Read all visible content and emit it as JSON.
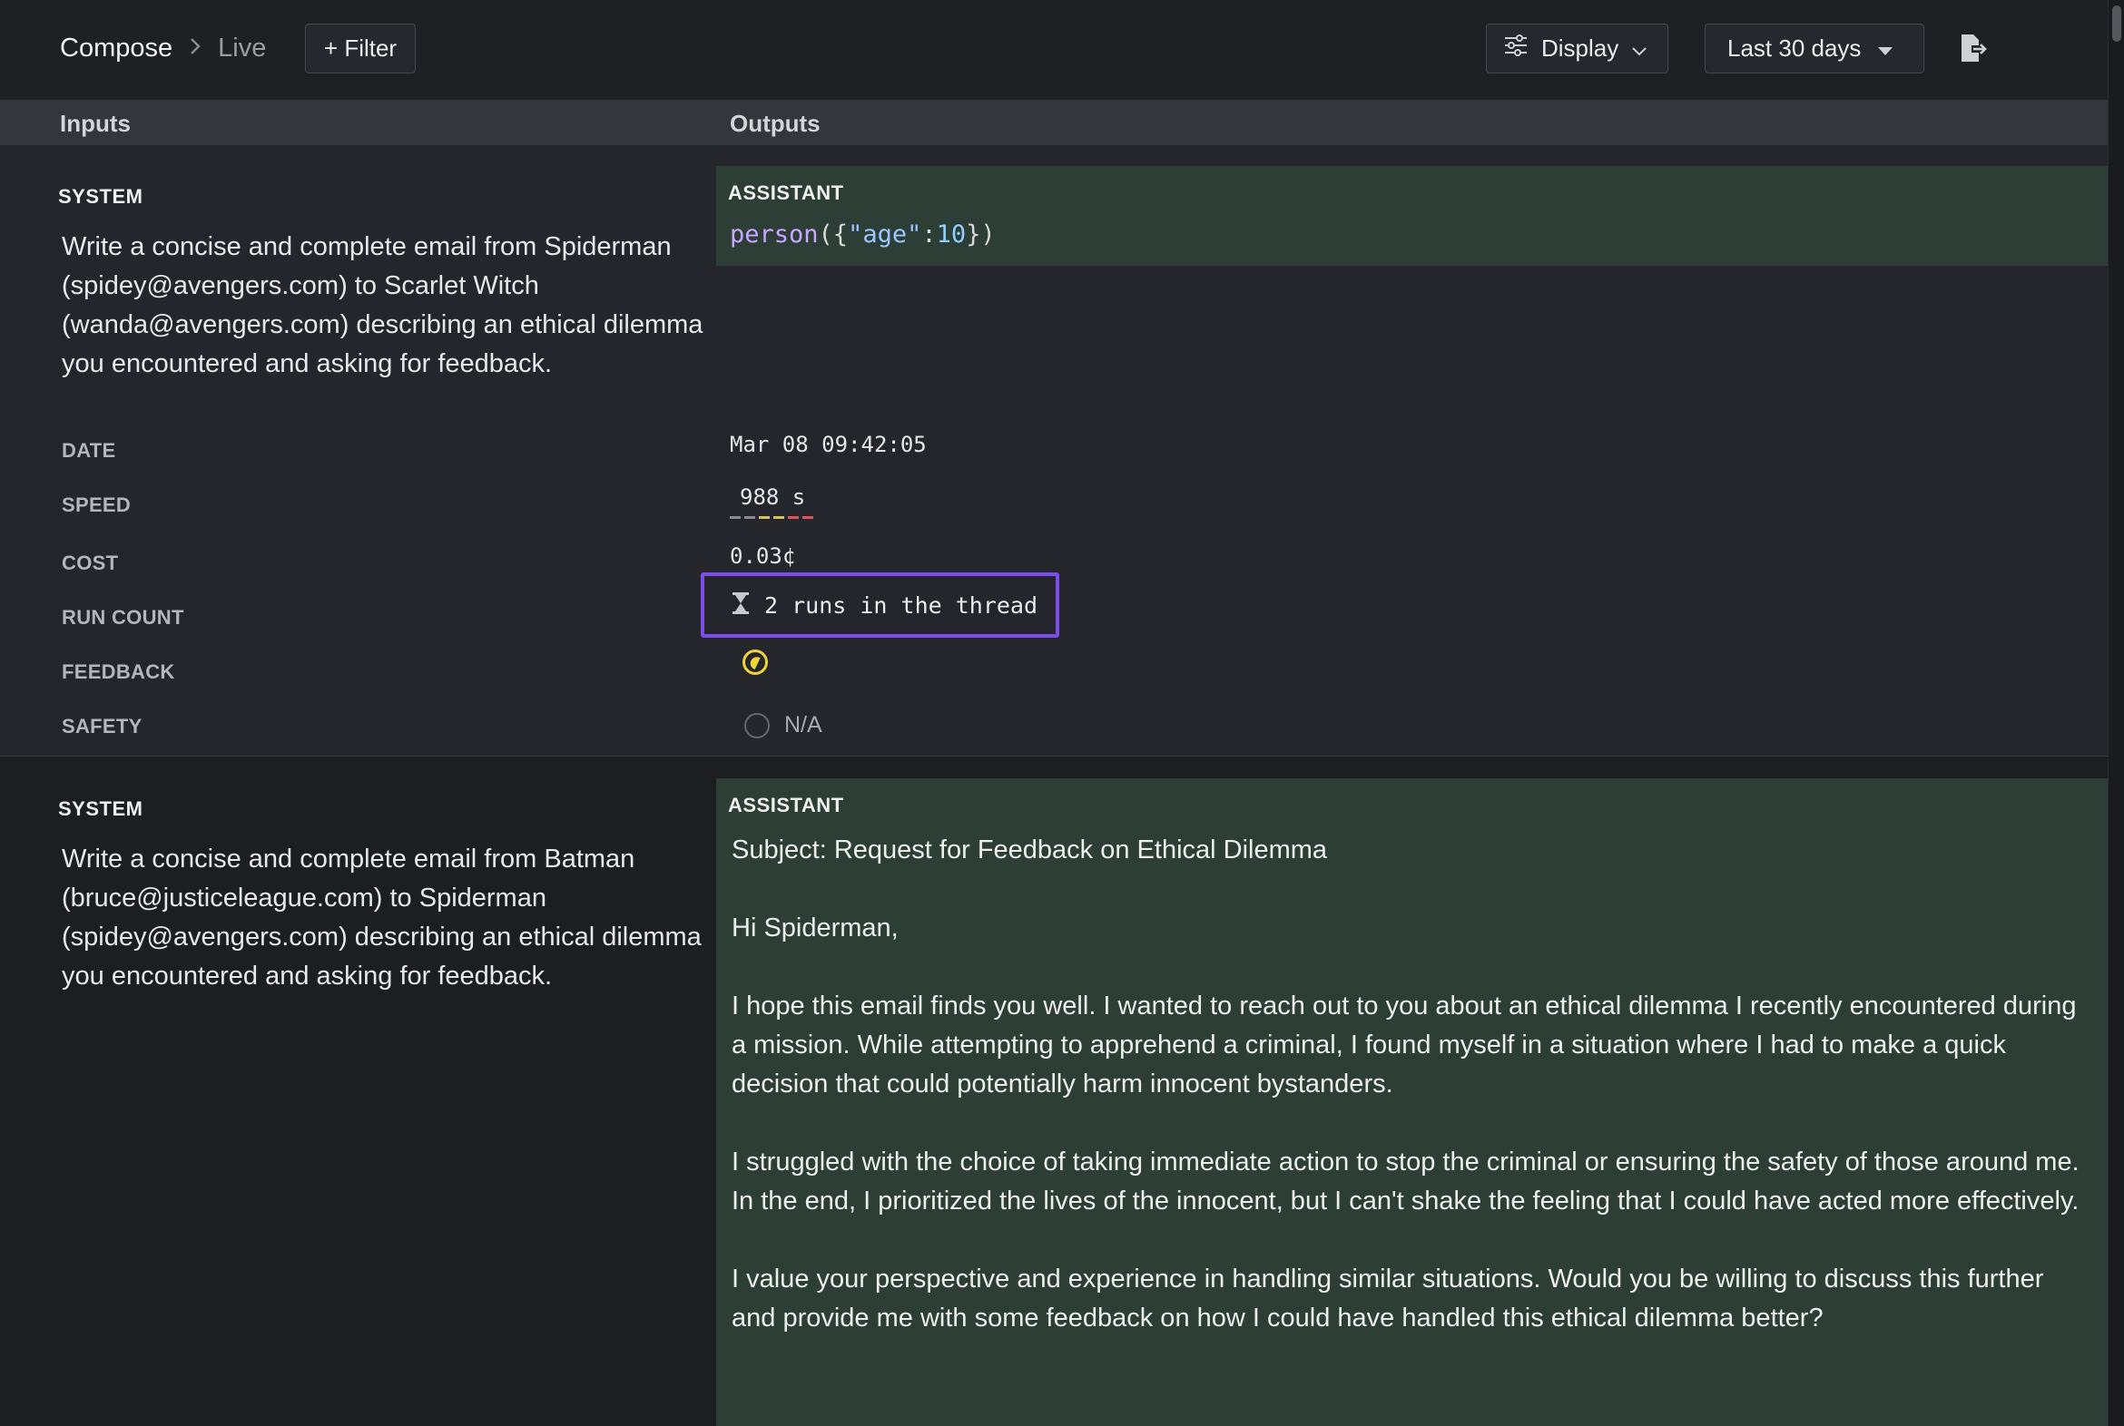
{
  "breadcrumb": {
    "root": "Compose",
    "current": "Live"
  },
  "toolbar": {
    "filter_label": "+ Filter",
    "display_label": "Display",
    "range_label": "Last 30 days"
  },
  "icons": {
    "breadcrumb_separator": "chevron-right-icon",
    "display": "sliders-icon",
    "display_caret": "chevron-down-icon",
    "range_caret": "caret-down-icon",
    "export": "export-icon",
    "runs": "hourglass-icon",
    "feedback": "feedback-icon",
    "safety": "circle-icon"
  },
  "columns": {
    "inputs": "Inputs",
    "outputs": "Outputs"
  },
  "colors": {
    "assistant_bg": "#2c3e36",
    "highlight": "#7b4cf0",
    "feedback": "#f0d23a"
  },
  "rows": [
    {
      "role": "SYSTEM",
      "input": "Write a concise and complete email from Spiderman (spidey@avengers.com) to Scarlet Witch (wanda@avengers.com) describing an ethical dilemma you encountered and asking for feedback.",
      "output_role": "ASSISTANT",
      "output_code": {
        "fn": "person",
        "open": "({",
        "key": "\"age\"",
        "colon": ":",
        "num": "10",
        "close": "})"
      },
      "meta": {
        "date_label": "DATE",
        "date": "Mar 08 09:42:05",
        "speed_label": "SPEED",
        "speed": "988 s",
        "cost_label": "COST",
        "cost": "0.03¢",
        "run_count_label": "RUN COUNT",
        "run_count": "2 runs in the thread",
        "feedback_label": "FEEDBACK",
        "safety_label": "SAFETY",
        "safety": "N/A"
      }
    },
    {
      "role": "SYSTEM",
      "input": "Write a concise and complete email from Batman (bruce@justiceleague.com) to Spiderman (spidey@avengers.com) describing an ethical dilemma you encountered and asking for feedback.",
      "output_role": "ASSISTANT",
      "output_paragraphs": [
        "Subject: Request for Feedback on Ethical Dilemma",
        "Hi Spiderman,",
        "I hope this email finds you well. I wanted to reach out to you about an ethical dilemma I recently encountered during a mission. While attempting to apprehend a criminal, I found myself in a situation where I had to make a quick decision that could potentially harm innocent bystanders.",
        "I struggled with the choice of taking immediate action to stop the criminal or ensuring the safety of those around me. In the end, I prioritized the lives of the innocent, but I can't shake the feeling that I could have acted more effectively.",
        "I value your perspective and experience in handling similar situations. Would you be willing to discuss this further and provide me with some feedback on how I could have handled this ethical dilemma better?"
      ]
    }
  ]
}
